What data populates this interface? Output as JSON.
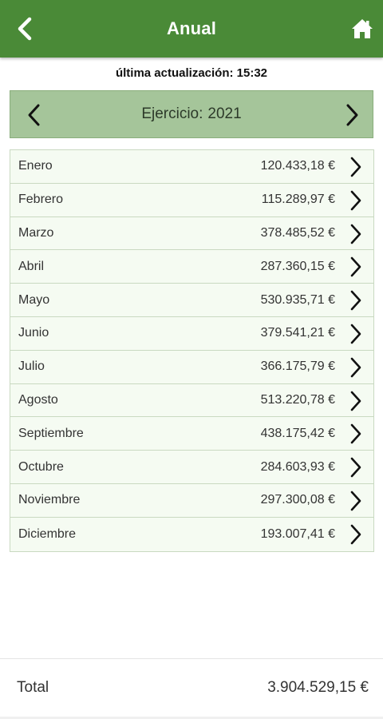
{
  "header": {
    "title": "Anual",
    "back_icon": "chevron-left-icon",
    "home_icon": "home-icon",
    "color": "#4a8a37"
  },
  "last_updated": "última actualización: 15:32",
  "year_selector": {
    "label": "Ejercicio:",
    "year": "2021",
    "prev_icon": "chevron-left-icon",
    "next_icon": "chevron-right-icon",
    "color": "#a5c59a"
  },
  "months": [
    {
      "name": "Enero",
      "amount": "120.433,18 €"
    },
    {
      "name": "Febrero",
      "amount": "115.289,97 €"
    },
    {
      "name": "Marzo",
      "amount": "378.485,52 €"
    },
    {
      "name": "Abril",
      "amount": "287.360,15 €"
    },
    {
      "name": "Mayo",
      "amount": "530.935,71 €"
    },
    {
      "name": "Junio",
      "amount": "379.541,21 €"
    },
    {
      "name": "Julio",
      "amount": "366.175,79 €"
    },
    {
      "name": "Agosto",
      "amount": "513.220,78 €"
    },
    {
      "name": "Septiembre",
      "amount": "438.175,42 €"
    },
    {
      "name": "Octubre",
      "amount": "284.603,93 €"
    },
    {
      "name": "Noviembre",
      "amount": "297.300,08 €"
    },
    {
      "name": "Diciembre",
      "amount": "193.007,41 €"
    }
  ],
  "total": {
    "label": "Total",
    "value": "3.904.529,15 €"
  }
}
